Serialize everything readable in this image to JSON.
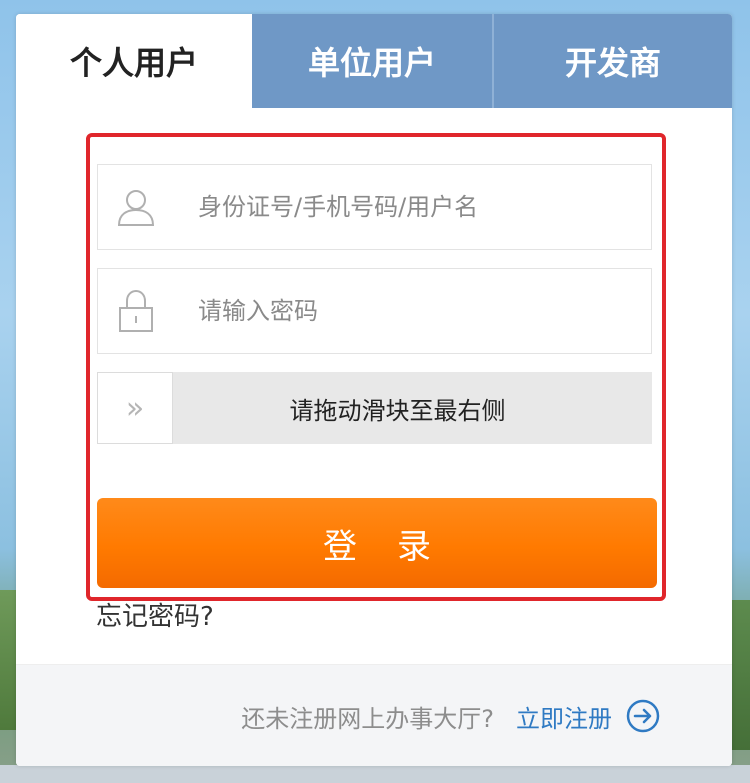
{
  "tabs": [
    {
      "label": "个人用户",
      "active": true
    },
    {
      "label": "单位用户",
      "active": false
    },
    {
      "label": "开发商",
      "active": false
    }
  ],
  "form": {
    "username_placeholder": "身份证号/手机号码/用户名",
    "password_placeholder": "请输入密码",
    "slider_text": "请拖动滑块至最右侧",
    "slider_handle_glyph": "»",
    "login_label": "登录",
    "forgot_label": "忘记密码?"
  },
  "footer": {
    "prompt": "还未注册网上办事大厅?",
    "register_label": "立即注册"
  },
  "icons": {
    "username": "user-icon",
    "password": "lock-icon",
    "slider": "double-chevron-right-icon",
    "register": "arrow-right-circle-icon"
  },
  "colors": {
    "tab_inactive": "#6f98c6",
    "login_button": "#ff7a00",
    "highlight_frame": "#e0262b",
    "link": "#2f7ac3"
  }
}
